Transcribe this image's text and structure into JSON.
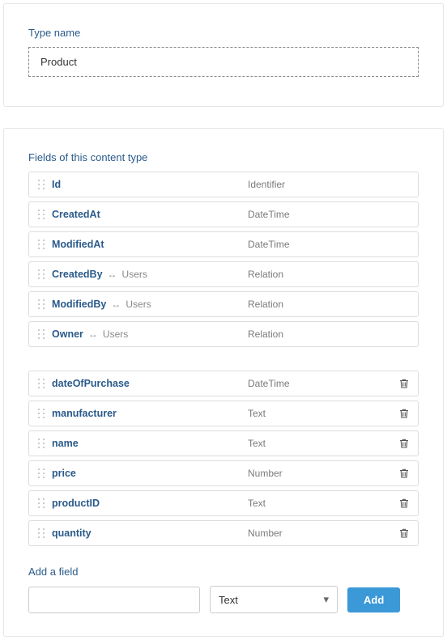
{
  "typeName": {
    "label": "Type name",
    "value": "Product"
  },
  "fieldsSection": {
    "label": "Fields of this content type"
  },
  "systemFields": [
    {
      "name": "Id",
      "type": "Identifier",
      "relation": null
    },
    {
      "name": "CreatedAt",
      "type": "DateTime",
      "relation": null
    },
    {
      "name": "ModifiedAt",
      "type": "DateTime",
      "relation": null
    },
    {
      "name": "CreatedBy",
      "type": "Relation",
      "relation": "Users"
    },
    {
      "name": "ModifiedBy",
      "type": "Relation",
      "relation": "Users"
    },
    {
      "name": "Owner",
      "type": "Relation",
      "relation": "Users"
    }
  ],
  "customFields": [
    {
      "name": "dateOfPurchase",
      "type": "DateTime"
    },
    {
      "name": "manufacturer",
      "type": "Text"
    },
    {
      "name": "name",
      "type": "Text"
    },
    {
      "name": "price",
      "type": "Number"
    },
    {
      "name": "productID",
      "type": "Text"
    },
    {
      "name": "quantity",
      "type": "Number"
    }
  ],
  "addField": {
    "label": "Add a field",
    "nameValue": "",
    "typeSelected": "Text",
    "buttonLabel": "Add"
  }
}
